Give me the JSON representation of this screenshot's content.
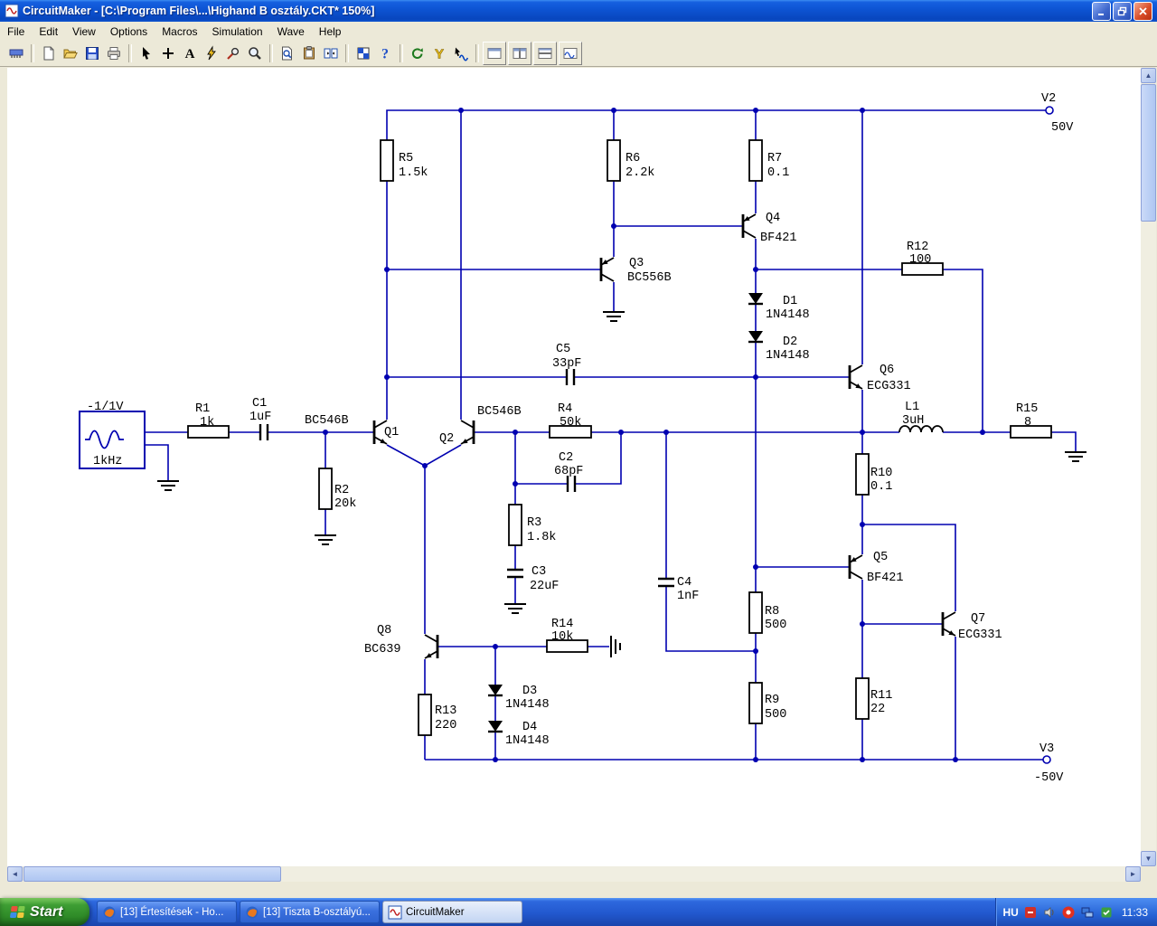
{
  "window": {
    "title": "CircuitMaker - [C:\\Program Files\\...\\Highand B osztály.CKT* 150%]",
    "control_icons": [
      "minimize",
      "restore",
      "close"
    ]
  },
  "menu": {
    "items": [
      "File",
      "Edit",
      "View",
      "Options",
      "Macros",
      "Simulation",
      "Wave",
      "Help"
    ]
  },
  "toolbar": {
    "icons": [
      "socket",
      "new-document",
      "open-folder",
      "save",
      "print",
      "selection-cursor",
      "wire-plus",
      "text-tool",
      "delete-zap",
      "probe",
      "zoom",
      "zoom-page",
      "board-copy",
      "split-view",
      "digital-grid",
      "help",
      "rotate",
      "probe-y",
      "run-probe",
      "scope-1",
      "scope-2",
      "scope-3",
      "scope-4"
    ],
    "glyph_a": "A",
    "glyph_help": "?",
    "glyph_y": "Y"
  },
  "circuit": {
    "power": {
      "v2_ref": "V2",
      "v2_val": "50V",
      "v3_ref": "V3",
      "v3_val": "-50V"
    },
    "source": {
      "label": "-1/1V",
      "freq": "1kHz"
    },
    "components": {
      "R1": {
        "ref": "R1",
        "val": "1k"
      },
      "R2": {
        "ref": "R2",
        "val": "20k"
      },
      "R3": {
        "ref": "R3",
        "val": "1.8k"
      },
      "R4": {
        "ref": "R4",
        "val": "50k"
      },
      "R5": {
        "ref": "R5",
        "val": "1.5k"
      },
      "R6": {
        "ref": "R6",
        "val": "2.2k"
      },
      "R7": {
        "ref": "R7",
        "val": "0.1"
      },
      "R8": {
        "ref": "R8",
        "val": "500"
      },
      "R9": {
        "ref": "R9",
        "val": "500"
      },
      "R10": {
        "ref": "R10",
        "val": "0.1"
      },
      "R11": {
        "ref": "R11",
        "val": "22"
      },
      "R12": {
        "ref": "R12",
        "val": "100"
      },
      "R13": {
        "ref": "R13",
        "val": "220"
      },
      "R14": {
        "ref": "R14",
        "val": "10k"
      },
      "R15": {
        "ref": "R15",
        "val": "8"
      },
      "C1": {
        "ref": "C1",
        "val": "1uF"
      },
      "C2": {
        "ref": "C2",
        "val": "68pF"
      },
      "C3": {
        "ref": "C3",
        "val": "22uF"
      },
      "C4": {
        "ref": "C4",
        "val": "1nF"
      },
      "C5": {
        "ref": "C5",
        "val": "33pF"
      },
      "L1": {
        "ref": "L1",
        "val": "3uH"
      },
      "D1": {
        "ref": "D1",
        "val": "1N4148"
      },
      "D2": {
        "ref": "D2",
        "val": "1N4148"
      },
      "D3": {
        "ref": "D3",
        "val": "1N4148"
      },
      "D4": {
        "ref": "D4",
        "val": "1N4148"
      },
      "Q1": {
        "ref": "Q1",
        "val": "BC546B"
      },
      "Q2": {
        "ref": "Q2",
        "val": "BC546B"
      },
      "Q3": {
        "ref": "Q3",
        "val": "BC556B"
      },
      "Q4": {
        "ref": "Q4",
        "val": "BF421"
      },
      "Q5": {
        "ref": "Q5",
        "val": "BF421"
      },
      "Q6": {
        "ref": "Q6",
        "val": "ECG331"
      },
      "Q7": {
        "ref": "Q7",
        "val": "ECG331"
      },
      "Q8": {
        "ref": "Q8",
        "val": "BC639"
      }
    }
  },
  "taskbar": {
    "start_label": "Start",
    "buttons": [
      {
        "label": "[13] Értesítések - Ho..."
      },
      {
        "label": "[13] Tiszta B-osztályú..."
      },
      {
        "label": "CircuitMaker"
      }
    ],
    "tray": {
      "language": "HU",
      "clock": "11:33",
      "icons": [
        "tray-red",
        "tray-volume",
        "tray-alert",
        "tray-network",
        "tray-green"
      ]
    }
  }
}
